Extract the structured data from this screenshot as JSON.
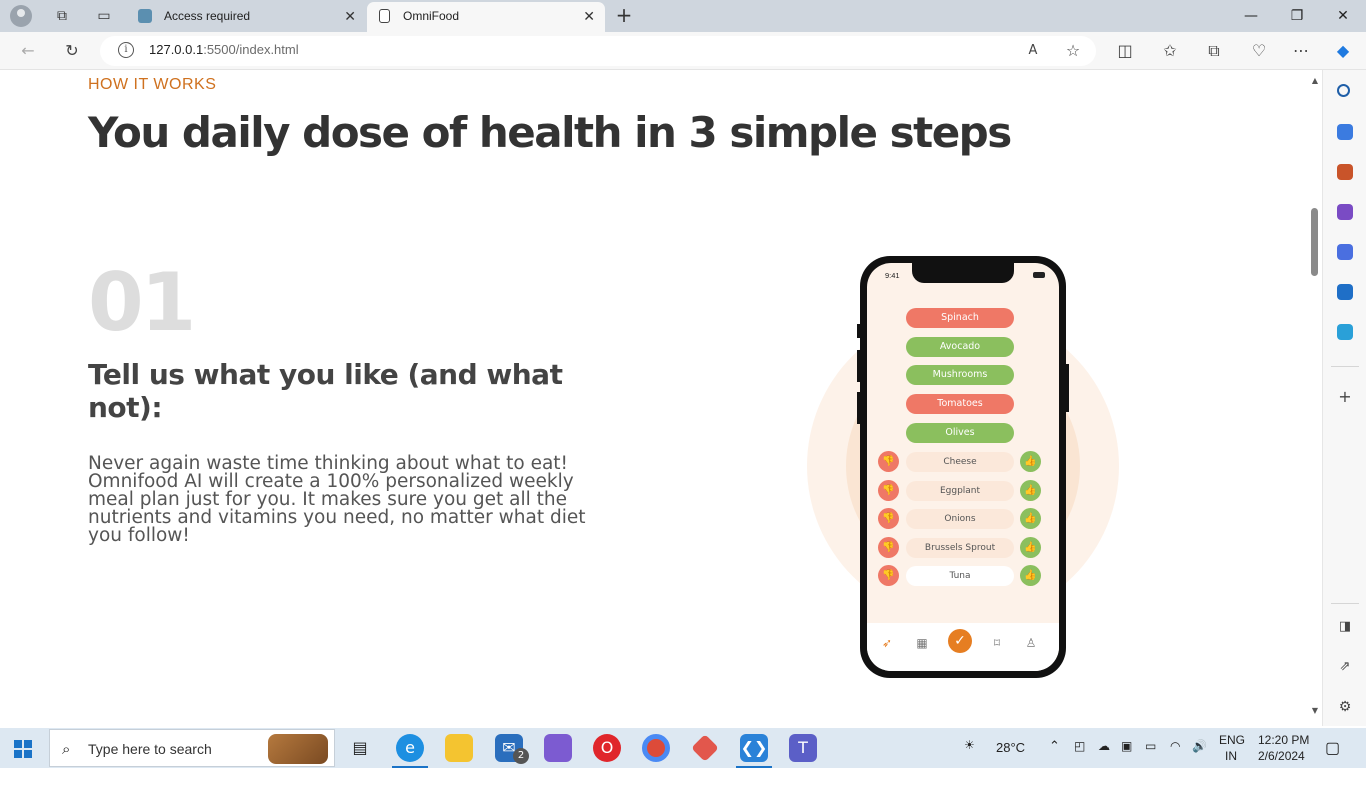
{
  "browser": {
    "tabs": [
      {
        "label": "Access required"
      },
      {
        "label": "OmniFood"
      }
    ],
    "url_host": "127.0.0.1",
    "url_rest": ":5500/index.html"
  },
  "page": {
    "subheading": "HOW IT WORKS",
    "heading": "You daily dose of health in 3 simple steps",
    "step_number": "01",
    "step_title": "Tell us what you like (and what not):",
    "step_description": "Never again waste time thinking about what to eat! Omnifood AI will create a 100% personalized weekly meal plan just for you. It makes sure you get all the nutrients and vitamins you need, no matter what diet you follow!"
  },
  "phone": {
    "time": "9:41",
    "selected_foods": [
      {
        "name": "Spinach",
        "color": "#ef7866"
      },
      {
        "name": "Avocado",
        "color": "#8bbf5e"
      },
      {
        "name": "Mushrooms",
        "color": "#8bbf5e"
      },
      {
        "name": "Tomatoes",
        "color": "#ef7866"
      },
      {
        "name": "Olives",
        "color": "#8bbf5e"
      }
    ],
    "rate_foods": [
      "Cheese",
      "Eggplant",
      "Onions",
      "Brussels Sprout",
      "Tuna"
    ],
    "tabbar_icons": [
      "rocket-icon",
      "calendar-icon",
      "check-icon",
      "bookmark-icon",
      "user-icon"
    ]
  },
  "colors": {
    "accent": "#cf711f",
    "like": "#8bbf5e",
    "dislike": "#ef7866",
    "primary_button": "#e67e22"
  },
  "taskbar": {
    "search_placeholder": "Type here to search",
    "weather": "28°C",
    "language": "ENG",
    "region": "IN",
    "time": "12:20 PM",
    "date": "2/6/2024",
    "mail_badge": "2"
  }
}
